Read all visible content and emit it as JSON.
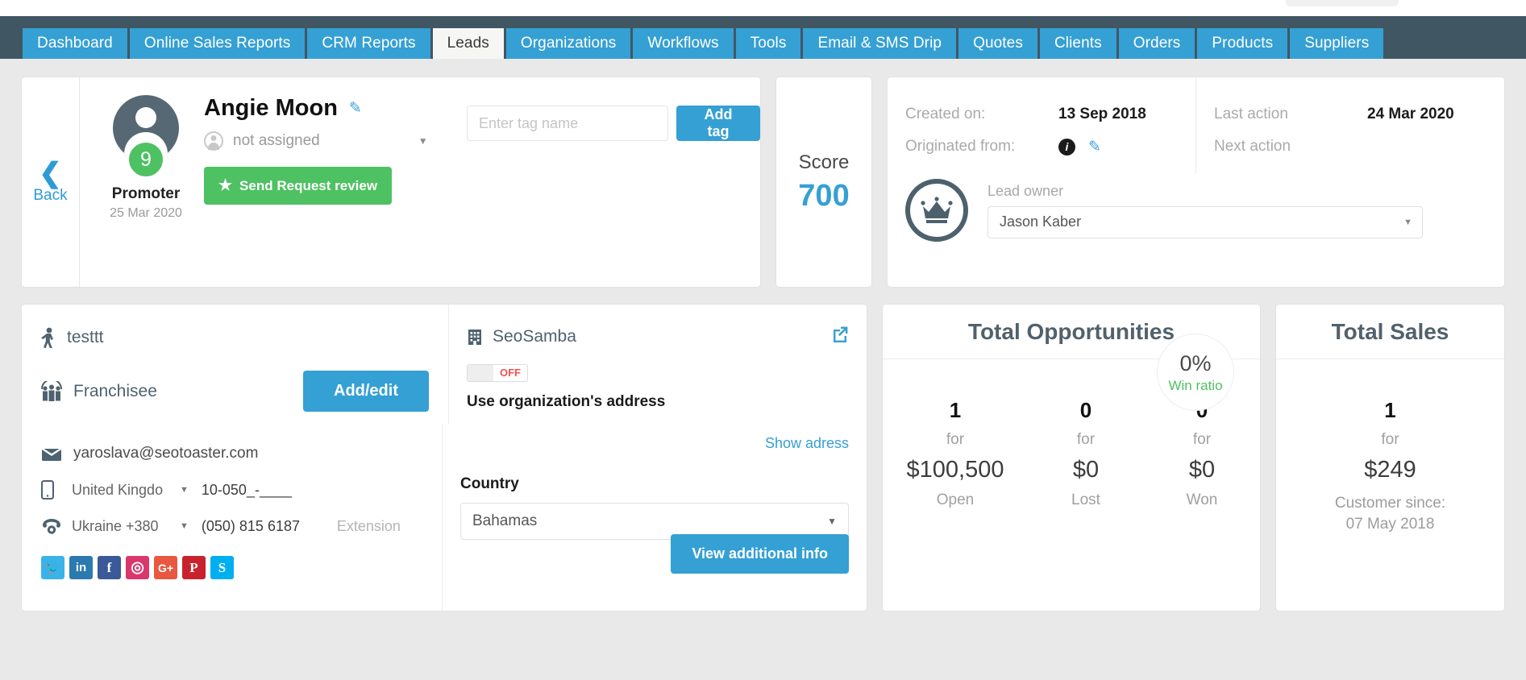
{
  "nav": {
    "tabs": [
      {
        "label": "Dashboard",
        "active": false
      },
      {
        "label": "Online Sales Reports",
        "active": false
      },
      {
        "label": "CRM Reports",
        "active": false
      },
      {
        "label": "Leads",
        "active": true
      },
      {
        "label": "Organizations",
        "active": false
      },
      {
        "label": "Workflows",
        "active": false
      },
      {
        "label": "Tools",
        "active": false
      },
      {
        "label": "Email & SMS Drip",
        "active": false
      },
      {
        "label": "Quotes",
        "active": false
      },
      {
        "label": "Clients",
        "active": false
      },
      {
        "label": "Orders",
        "active": false
      },
      {
        "label": "Products",
        "active": false
      },
      {
        "label": "Suppliers",
        "active": false
      }
    ]
  },
  "back": {
    "label": "Back"
  },
  "profile": {
    "name": "Angie Moon",
    "score_badge": "9",
    "promoter_label": "Promoter",
    "promoter_date": "25 Mar 2020",
    "assigned_text": "not assigned",
    "review_button": "Send Request review"
  },
  "tags": {
    "placeholder": "Enter tag name",
    "value": "",
    "add_button": "Add tag"
  },
  "score": {
    "title": "Score",
    "value": "700"
  },
  "meta": {
    "created_on_label": "Created on:",
    "created_on_value": "13 Sep 2018",
    "originated_from_label": "Originated from:",
    "last_action_label": "Last action",
    "last_action_value": "24 Mar 2020",
    "next_action_label": "Next action",
    "next_action_value": ""
  },
  "owner": {
    "label": "Lead owner",
    "value": "Jason Kaber"
  },
  "contact": {
    "person_type": "testtt",
    "franchisee_label": "Franchisee",
    "add_edit_button": "Add/edit",
    "organization": "SeoSamba",
    "toggle_state": "OFF",
    "use_org_address": "Use organization's address",
    "email": "yaroslava@seotoaster.com",
    "phones": [
      {
        "country": "United Kingdo",
        "number": "10-050_-____",
        "extension_placeholder": ""
      },
      {
        "country": "Ukraine +380",
        "number": "(050) 815 6187",
        "extension_placeholder": "Extension"
      }
    ],
    "socials": [
      {
        "name": "twitter-icon",
        "glyph": "🐦",
        "color": "#3ab3e8"
      },
      {
        "name": "linkedin-icon",
        "glyph": "in",
        "color": "#2a7ab0"
      },
      {
        "name": "facebook-icon",
        "glyph": "f",
        "color": "#3b5998"
      },
      {
        "name": "instagram-icon",
        "glyph": "◎",
        "color": "#d9376e"
      },
      {
        "name": "googleplus-icon",
        "glyph": "G+",
        "color": "#e8573f"
      },
      {
        "name": "pinterest-icon",
        "glyph": "P",
        "color": "#c8232c"
      },
      {
        "name": "skype-icon",
        "glyph": "S",
        "color": "#00aff0"
      }
    ],
    "show_address": "Show adress",
    "country_label": "Country",
    "country_value": "Bahamas",
    "view_additional_info": "View additional info"
  },
  "opportunities": {
    "title": "Total Opportunities",
    "win_ratio_value": "0%",
    "win_ratio_label": "Win ratio",
    "columns": [
      {
        "count": "1",
        "for": "for",
        "amount": "$100,500",
        "state": "Open"
      },
      {
        "count": "0",
        "for": "for",
        "amount": "$0",
        "state": "Lost"
      },
      {
        "count": "0",
        "for": "for",
        "amount": "$0",
        "state": "Won"
      }
    ]
  },
  "sales": {
    "title": "Total Sales",
    "count": "1",
    "for": "for",
    "amount": "$249",
    "since_label": "Customer since:",
    "since_date": "07 May 2018"
  },
  "colors": {
    "nav_bg": "#415663",
    "tab_blue": "#35a0d3",
    "green": "#4ec163",
    "page_bg": "#e9e9e9"
  }
}
